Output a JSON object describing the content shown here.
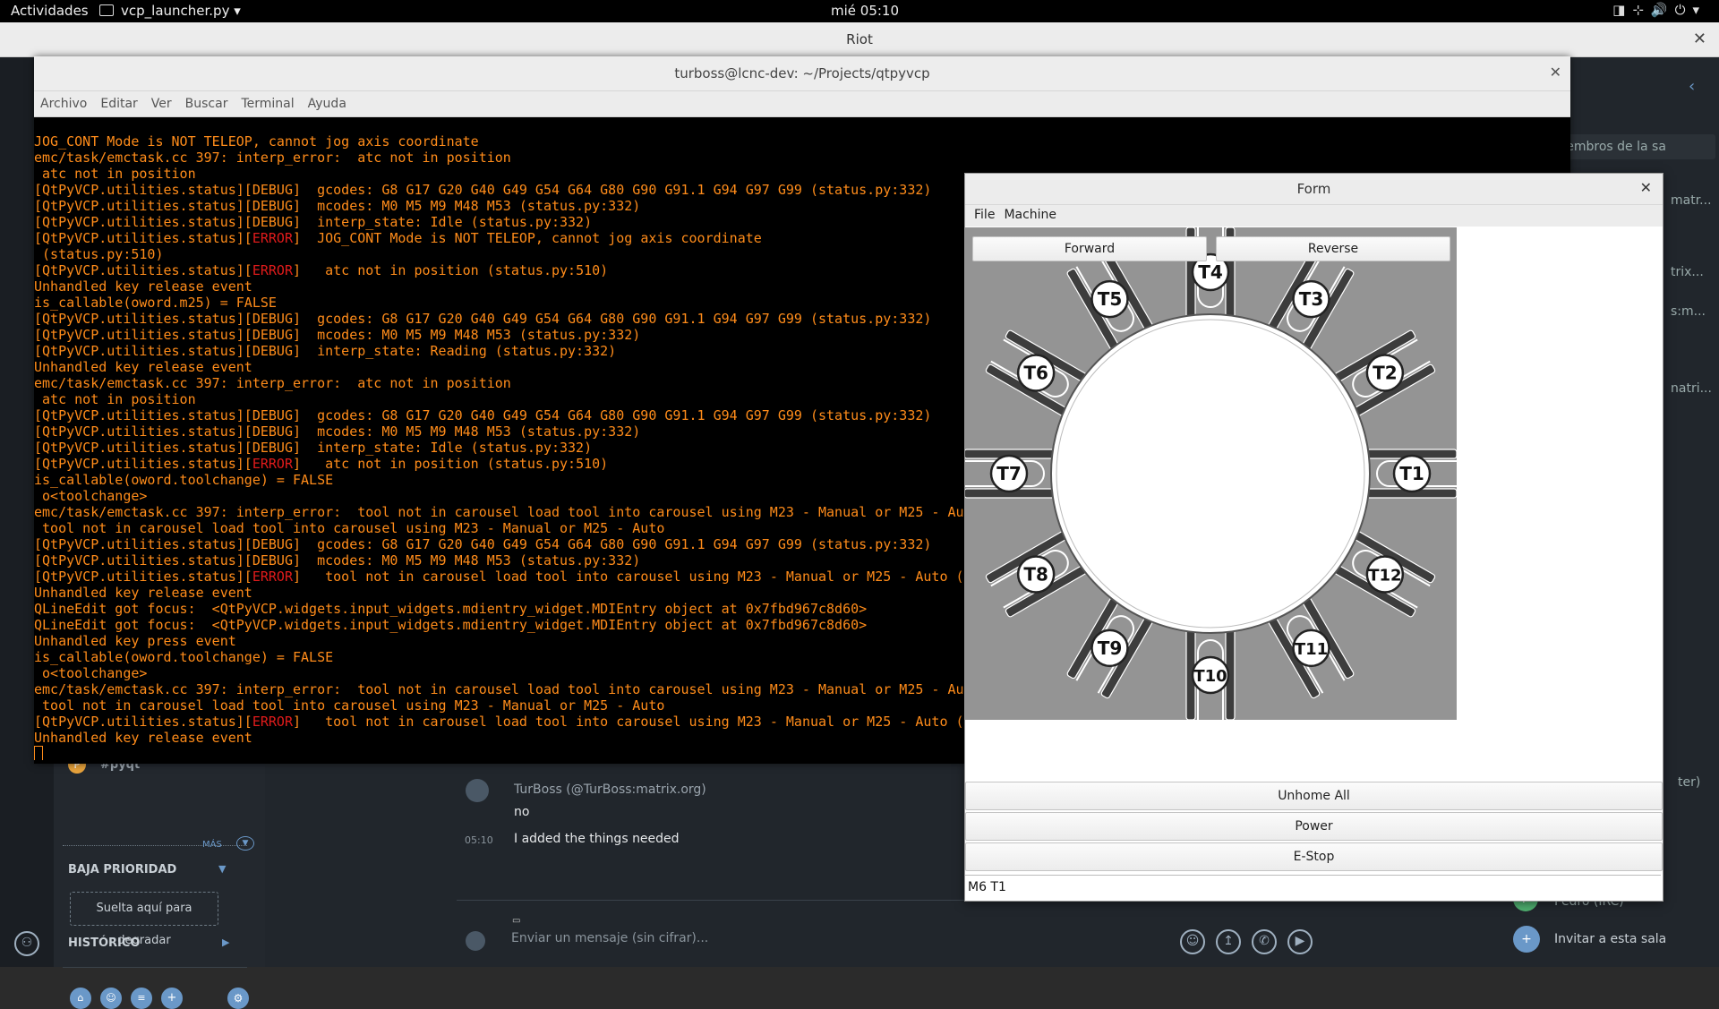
{
  "topbar": {
    "activities": "Actividades",
    "app_name": "vcp_launcher.py",
    "clock": "mié 05:10",
    "tray_icons": [
      "screen-icon",
      "network-icon",
      "volume-icon",
      "power-icon",
      "chevron-down-icon"
    ]
  },
  "riot": {
    "window_title": "Riot",
    "room_name": "#pyqt",
    "more_label": "MÁS",
    "low_priority": "BAJA PRIORIDAD",
    "drop_hint": "Suelta aquí para degradar",
    "history": "HISTÓRICO",
    "message_sender": "TurBoss (@TurBoss:matrix.org)",
    "messages": [
      {
        "time": "",
        "text": "no"
      },
      {
        "time": "05:10",
        "text": "I added the things needed"
      }
    ],
    "composer_placeholder": "Enviar un mensaje (sin cifrar)...",
    "right_panel": {
      "members_search": "s miembros de la sa",
      "frag1": "matr...",
      "frag2": "trix...",
      "frag3": "s:m...",
      "frag4": "natri...",
      "frag5": "ter)",
      "member_irc": "Pedro (IRC)",
      "invite": "Invitar a esta sala"
    }
  },
  "terminal": {
    "title": "turboss@lcnc-dev: ~/Projects/qtpyvcp",
    "menu": [
      "Archivo",
      "Editar",
      "Ver",
      "Buscar",
      "Terminal",
      "Ayuda"
    ]
  },
  "form": {
    "title": "Form",
    "menu": [
      "File",
      "Machine"
    ],
    "forward_label": "Forward",
    "reverse_label": "Reverse",
    "tools": [
      "T1",
      "T2",
      "T3",
      "T4",
      "T5",
      "T6",
      "T7",
      "T8",
      "T9",
      "T10",
      "T11",
      "T12"
    ],
    "unhome_label": "Unhome All",
    "power_label": "Power",
    "estop_label": "E-Stop",
    "mdi_value": "M6 T1"
  },
  "colors": {
    "terminal_text": "#ff8c1a",
    "terminal_error": "#e01b1b",
    "riot_bg": "#21262c"
  }
}
